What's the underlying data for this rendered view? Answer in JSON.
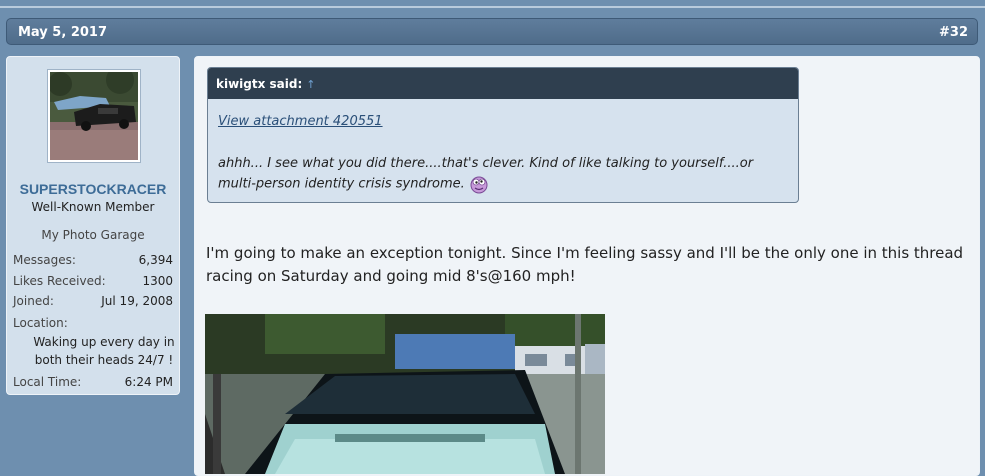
{
  "post": {
    "date": "May 5, 2017",
    "number": "#32"
  },
  "user": {
    "name": "SUPERSTOCKRACER",
    "title": "Well-Known Member",
    "garage_link": "My Photo Garage",
    "stats": {
      "messages_label": "Messages:",
      "messages_value": "6,394",
      "likes_label": "Likes Received:",
      "likes_value": "1300",
      "joined_label": "Joined:",
      "joined_value": "Jul 19, 2008",
      "location_label": "Location:",
      "location_value": "Waking up every day in both their heads 24/7 !",
      "localtime_label": "Local Time:",
      "localtime_value": "6:24 PM"
    }
  },
  "quote": {
    "author": "kiwigtx said:",
    "arrow": "↑",
    "attachment_link": "View attachment 420551",
    "text": "ahhh... I see what you did there....that's clever. Kind of like talking to yourself....or multi-person identity crisis syndrome."
  },
  "message": {
    "body": "I'm going to make an exception tonight. Since I'm feeling sassy and I'll be the only one in this thread racing on Saturday and going mid 8's@160 mph!"
  },
  "colors": {
    "page_bg": "#6e8faf",
    "header_bg": "#4f6c8a",
    "username": "#3d6c97",
    "quote_head": "#2f3f4f"
  }
}
